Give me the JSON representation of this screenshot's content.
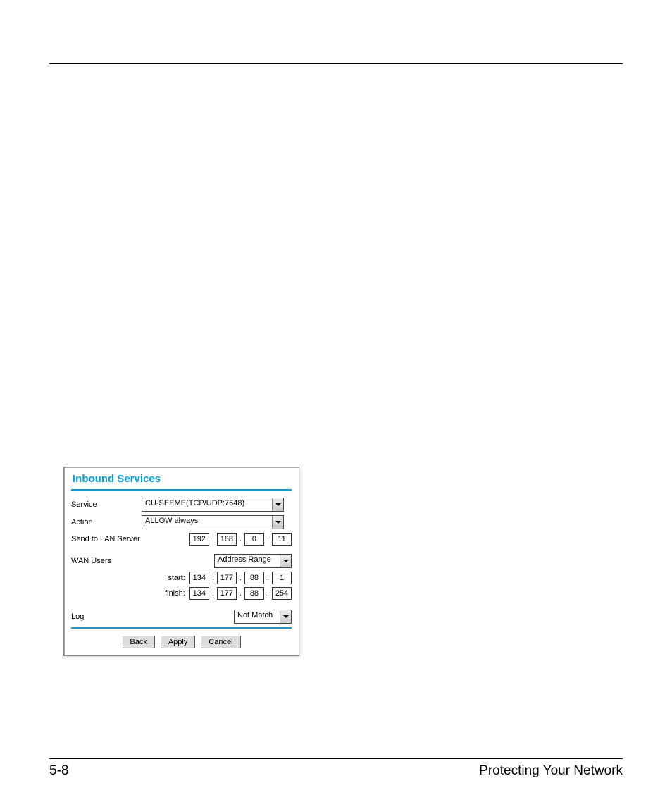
{
  "panel": {
    "title": "Inbound Services",
    "service": {
      "label": "Service",
      "value": "CU-SEEME(TCP/UDP:7648)"
    },
    "action": {
      "label": "Action",
      "value": "ALLOW always"
    },
    "lan": {
      "label": "Send to LAN Server",
      "ip": [
        "192",
        "168",
        "0",
        "11"
      ]
    },
    "wan": {
      "label": "WAN Users",
      "value": "Address Range",
      "start_label": "start:",
      "start_ip": [
        "134",
        "177",
        "88",
        "1"
      ],
      "finish_label": "finish:",
      "finish_ip": [
        "134",
        "177",
        "88",
        "254"
      ]
    },
    "log": {
      "label": "Log",
      "value": "Not Match"
    },
    "buttons": {
      "back": "Back",
      "apply": "Apply",
      "cancel": "Cancel"
    }
  },
  "footer": {
    "page": "5-8",
    "section": "Protecting Your Network"
  }
}
